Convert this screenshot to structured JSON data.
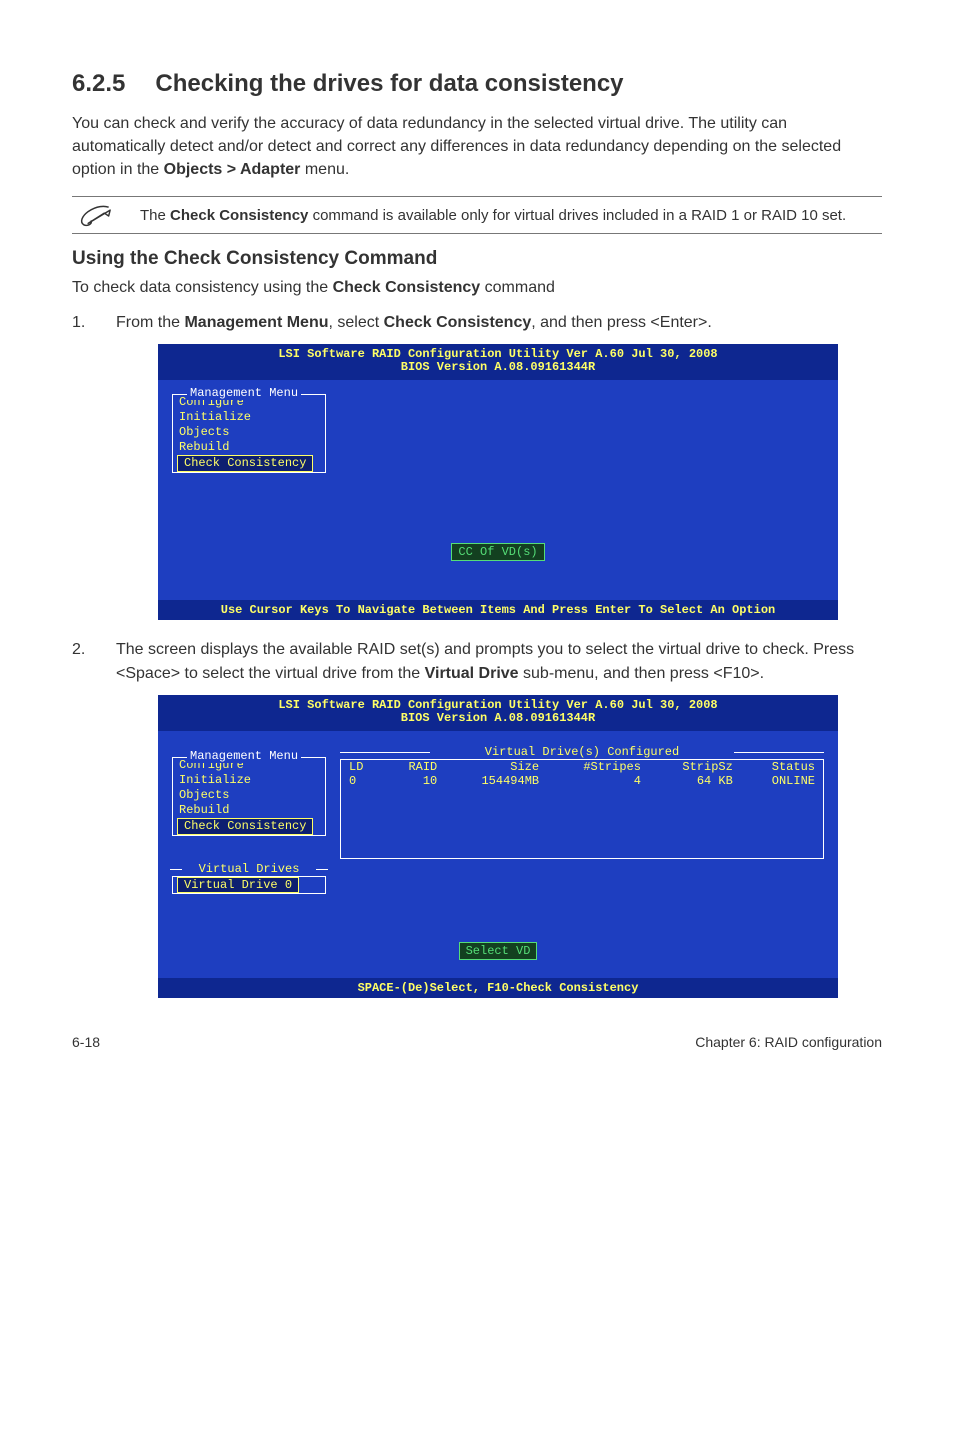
{
  "section": {
    "number": "6.2.5",
    "title": "Checking the drives for data consistency"
  },
  "intro": {
    "prefix": "You can check and verify the accuracy of data redundancy in the selected virtual drive. The utility can automatically detect and/or detect and correct any differences in data redundancy depending on the selected option in the ",
    "bold": "Objects > Adapter",
    "suffix": " menu."
  },
  "note": {
    "pre": "The ",
    "bold": "Check Consistency",
    "post": " command is available only for virtual drives included in a RAID 1 or RAID 10 set."
  },
  "sub_heading": "Using the Check Consistency Command",
  "sub_intro": {
    "pre": "To check data consistency using the ",
    "bold": "Check Consistency",
    "post": " command"
  },
  "steps": [
    {
      "num": "1.",
      "pre": "From the ",
      "b1": "Management Menu",
      "mid": ", select ",
      "b2": "Check Consistency",
      "post": ", and then press <Enter>."
    }
  ],
  "bios1": {
    "title_line1": "LSI Software RAID Configuration Utility Ver A.60 Jul 30, 2008",
    "title_line2": "BIOS Version   A.08.09161344R",
    "menu_label": "Management Menu",
    "items": [
      "Configure",
      "Initialize",
      "Objects",
      "Rebuild",
      "Check Consistency"
    ],
    "cc_button": "CC Of VD(s)",
    "footer": "Use Cursor Keys To Navigate Between Items And Press Enter To Select An Option"
  },
  "step2": {
    "num": "2.",
    "pre": "The screen displays the available RAID set(s) and prompts you to select the virtual drive to check. Press <Space> to select the virtual drive from the ",
    "b1": "Virtual Drive",
    "post": " sub-menu, and then press <F10>."
  },
  "bios2": {
    "title_line1": "LSI Software RAID Configuration Utility Ver A.60 Jul 30, 2008",
    "title_line2": "BIOS Version   A.08.09161344R",
    "menu_label": "Management Menu",
    "items": [
      "Configure",
      "Initialize",
      "Objects",
      "Rebuild",
      "Check Consistency"
    ],
    "vd_label": "Virtual Drives",
    "vd_item": "Virtual Drive 0",
    "table_title": "Virtual Drive(s) Configured",
    "headers": [
      "LD",
      "RAID",
      "Size",
      "#Stripes",
      "StripSz",
      "Status"
    ],
    "row": [
      "0",
      "10",
      "154494MB",
      "4",
      "64 KB",
      "ONLINE"
    ],
    "select_vd": "Select VD",
    "footer": "SPACE-(De)Select,    F10-Check Consistency"
  },
  "page_footer": {
    "left": "6-18",
    "right": "Chapter 6: RAID configuration"
  }
}
